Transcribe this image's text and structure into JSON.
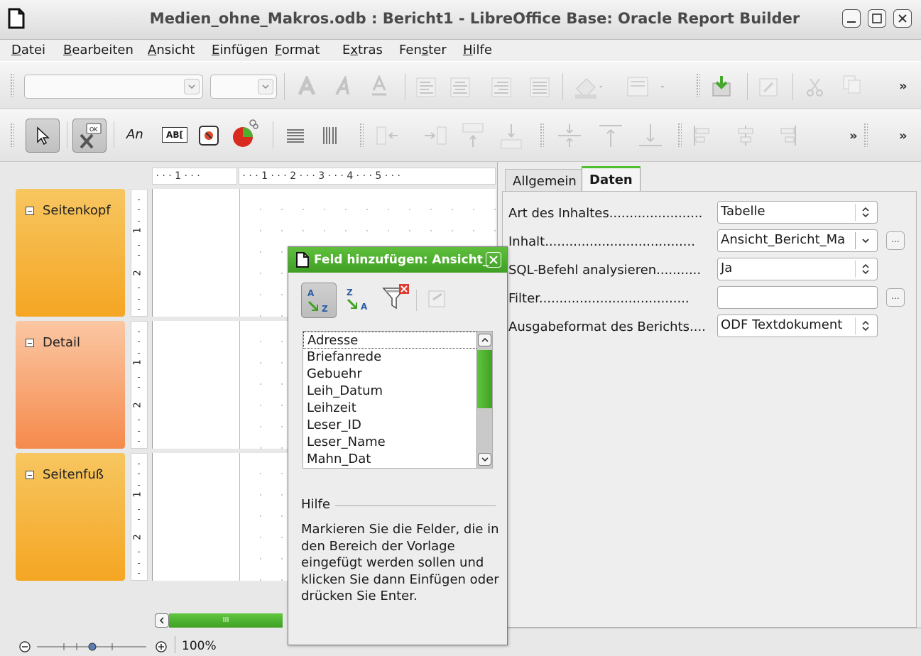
{
  "window": {
    "title": "Medien_ohne_Makros.odb : Bericht1 - LibreOffice Base: Oracle Report Builder"
  },
  "menu": {
    "items": [
      {
        "underline": "D",
        "rest": "atei"
      },
      {
        "underline": "B",
        "rest": "earbeiten"
      },
      {
        "underline": "A",
        "rest": "nsicht"
      },
      {
        "underline": "E",
        "rest": "infügen"
      },
      {
        "underline": "F",
        "rest": "ormat"
      },
      {
        "before": "E",
        "underline": "x",
        "rest": "tras"
      },
      {
        "before": "Fen",
        "underline": "s",
        "rest": "ter"
      },
      {
        "underline": "H",
        "rest": "ilfe"
      }
    ]
  },
  "toolbar1": {
    "font_name_value": "",
    "font_size_value": "",
    "overflow": "»"
  },
  "toolbar2": {
    "label_field_text": "An",
    "text_field_text": "AB[",
    "overflow_inner": "»",
    "overflow": "»"
  },
  "design": {
    "ruler_left": " · · · 1 · · · ",
    "ruler_main": " · · · 1 · · · 2 · · · 3 · · · 4 · · · 5 · · · ",
    "sections": [
      {
        "label": "Seitenkopf"
      },
      {
        "label": "Detail"
      },
      {
        "label": "Seitenfuß"
      }
    ],
    "vruler_numbers": [
      "1",
      "2"
    ],
    "scroll_thumb_mark": "III",
    "zoom_level": "100%"
  },
  "properties": {
    "tabs": [
      {
        "label": "Allgemein",
        "active": false
      },
      {
        "label": "Daten",
        "active": true
      }
    ],
    "rows": [
      {
        "label": "Art des Inhaltes.......................",
        "value": "Tabelle"
      },
      {
        "label": "Inhalt.....................................",
        "value": "Ansicht_Bericht_Ma"
      },
      {
        "label": "SQL-Befehl analysieren...........",
        "value": "Ja"
      },
      {
        "label": "Filter.....................................",
        "value": ""
      },
      {
        "label": "Ausgabeformat des Berichts....",
        "value": "ODF Textdokument"
      }
    ],
    "browse_label": "..."
  },
  "dialog": {
    "title": "Feld hinzufügen: Ansicht_",
    "fields": [
      "Adresse",
      "Briefanrede",
      "Gebuehr",
      "Leih_Datum",
      "Leihzeit",
      "Leser_ID",
      "Leser_Name",
      "Mahn_Dat"
    ],
    "hilfe_label": "Hilfe",
    "hilfe_text": "Markieren Sie die Felder, die in den Bereich der Vorlage eingefügt werden sollen und klicken Sie dann Einfügen oder drücken Sie Enter."
  },
  "colors": {
    "accent_green": "#4fbf2f",
    "section_header": "#f5b335",
    "section_detail": "#f59a62",
    "section_footer": "#f5b335"
  }
}
